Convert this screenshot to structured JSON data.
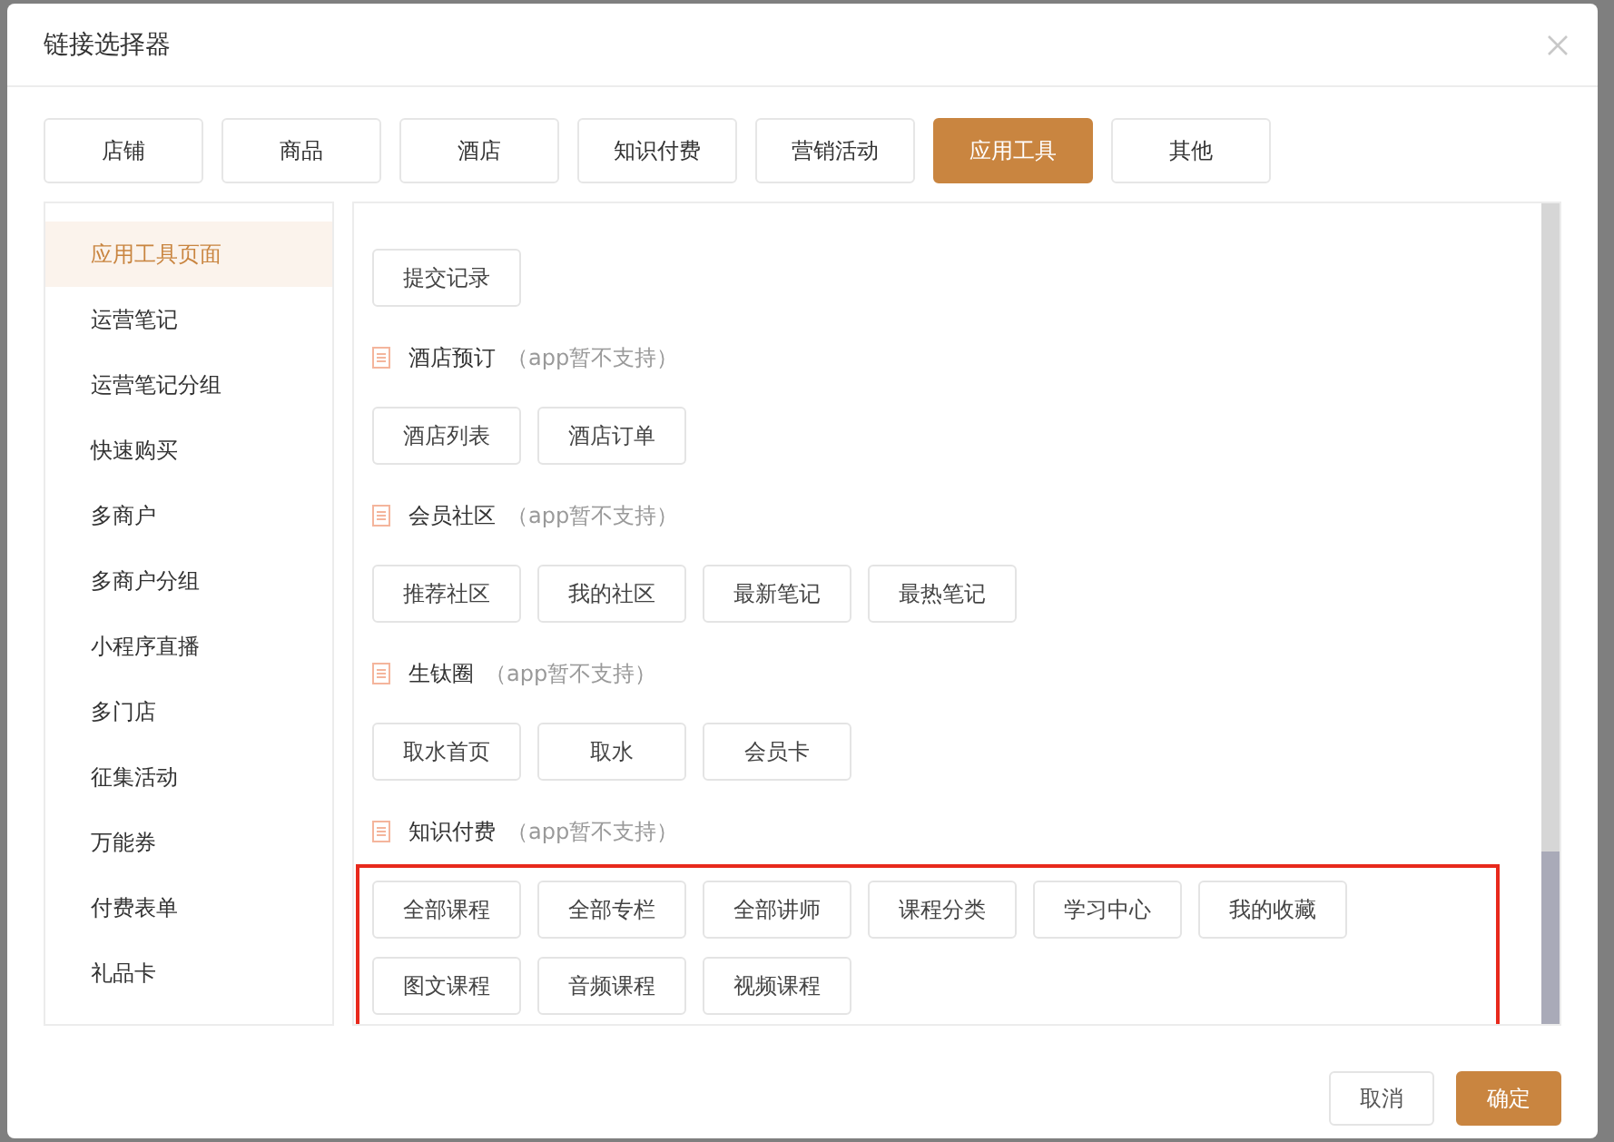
{
  "dialog": {
    "title": "链接选择器"
  },
  "tabs": [
    {
      "label": "店铺",
      "selected": false
    },
    {
      "label": "商品",
      "selected": false
    },
    {
      "label": "酒店",
      "selected": false
    },
    {
      "label": "知识付费",
      "selected": false
    },
    {
      "label": "营销活动",
      "selected": false
    },
    {
      "label": "应用工具",
      "selected": true
    },
    {
      "label": "其他",
      "selected": false
    }
  ],
  "sidebar": {
    "items": [
      {
        "label": "应用工具页面",
        "selected": true
      },
      {
        "label": "运营笔记",
        "selected": false
      },
      {
        "label": "运营笔记分组",
        "selected": false
      },
      {
        "label": "快速购买",
        "selected": false
      },
      {
        "label": "多商户",
        "selected": false
      },
      {
        "label": "多商户分组",
        "selected": false
      },
      {
        "label": "小程序直播",
        "selected": false
      },
      {
        "label": "多门店",
        "selected": false
      },
      {
        "label": "征集活动",
        "selected": false
      },
      {
        "label": "万能券",
        "selected": false
      },
      {
        "label": "付费表单",
        "selected": false
      },
      {
        "label": "礼品卡",
        "selected": false
      }
    ]
  },
  "sections": [
    {
      "links": [
        "提交记录"
      ],
      "highlighted": false
    },
    {
      "title": "酒店预订",
      "note": "（app暂不支持）",
      "links": [
        "酒店列表",
        "酒店订单"
      ],
      "highlighted": false
    },
    {
      "title": "会员社区",
      "note": "（app暂不支持）",
      "links": [
        "推荐社区",
        "我的社区",
        "最新笔记",
        "最热笔记"
      ],
      "highlighted": false
    },
    {
      "title": "生钛圈",
      "note": "（app暂不支持）",
      "links": [
        "取水首页",
        "取水",
        "会员卡"
      ],
      "highlighted": false
    },
    {
      "title": "知识付费",
      "note": "（app暂不支持）",
      "links": [
        "全部课程",
        "全部专栏",
        "全部讲师",
        "课程分类",
        "学习中心",
        "我的收藏",
        "图文课程",
        "音频课程",
        "视频课程"
      ],
      "highlighted": true
    }
  ],
  "footer": {
    "buttons": [
      {
        "label": "取消",
        "kind": "secondary"
      },
      {
        "label": "确定",
        "kind": "primary"
      }
    ]
  }
}
